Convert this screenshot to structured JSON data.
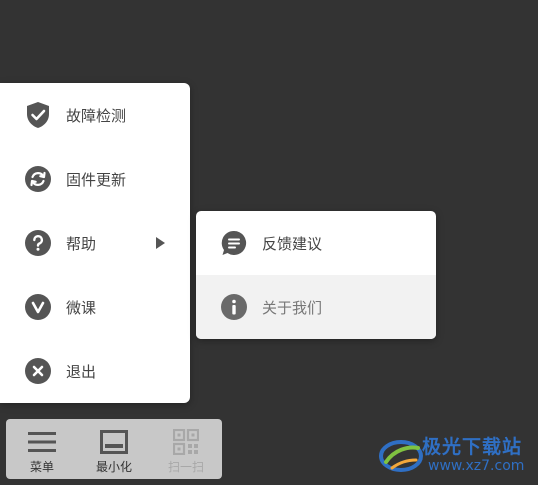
{
  "menu": {
    "items": [
      {
        "label": "故障检测",
        "icon": "shield-check-icon"
      },
      {
        "label": "固件更新",
        "icon": "refresh-icon"
      },
      {
        "label": "帮助",
        "icon": "question-icon",
        "has_submenu": true
      },
      {
        "label": "微课",
        "icon": "chevron-down-circle-icon"
      },
      {
        "label": "退出",
        "icon": "close-circle-icon"
      }
    ]
  },
  "submenu": {
    "items": [
      {
        "label": "反馈建议",
        "icon": "chat-bubble-icon"
      },
      {
        "label": "关于我们",
        "icon": "info-icon"
      }
    ]
  },
  "bottombar": {
    "menu_label": "菜单",
    "minimize_label": "最小化",
    "scan_label": "扫一扫"
  },
  "watermark": {
    "title": "极光下载站",
    "url": "www.xz7.com"
  },
  "colors": {
    "background": "#333333",
    "icon": "#555555",
    "watermark_blue": "#2f6fc4"
  }
}
